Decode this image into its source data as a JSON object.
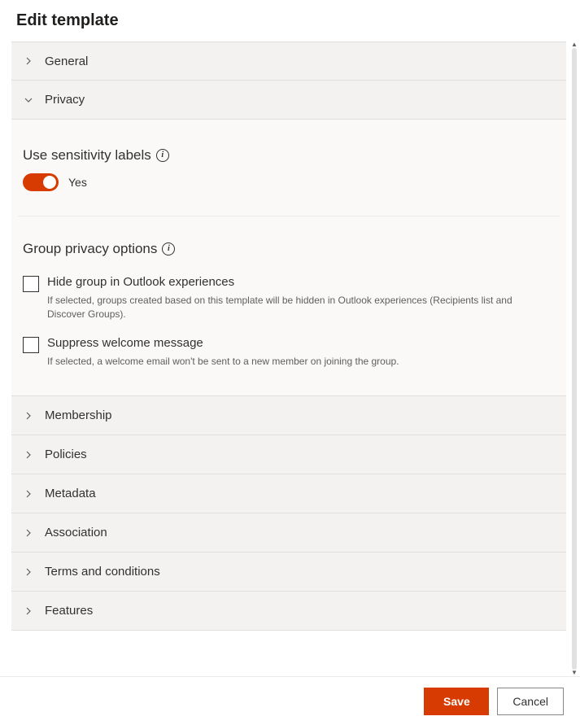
{
  "page_title": "Edit template",
  "sections": {
    "general": {
      "label": "General",
      "expanded": false
    },
    "privacy": {
      "label": "Privacy",
      "expanded": true
    },
    "membership": {
      "label": "Membership",
      "expanded": false
    },
    "policies": {
      "label": "Policies",
      "expanded": false
    },
    "metadata": {
      "label": "Metadata",
      "expanded": false
    },
    "association": {
      "label": "Association",
      "expanded": false
    },
    "terms": {
      "label": "Terms and conditions",
      "expanded": false
    },
    "features": {
      "label": "Features",
      "expanded": false
    }
  },
  "privacy_body": {
    "sensitivity": {
      "label": "Use sensitivity labels",
      "toggle_state": "Yes",
      "toggle_on": true
    },
    "group_privacy_title": "Group privacy options",
    "options": {
      "hide_outlook": {
        "label": "Hide group in Outlook experiences",
        "desc": "If selected, groups created based on this template will be hidden in Outlook experiences (Recipients list and Discover Groups).",
        "checked": false
      },
      "suppress_welcome": {
        "label": "Suppress welcome message",
        "desc": "If selected, a welcome email won't be sent to a new member on joining the group.",
        "checked": false
      }
    }
  },
  "footer": {
    "save": "Save",
    "cancel": "Cancel"
  }
}
